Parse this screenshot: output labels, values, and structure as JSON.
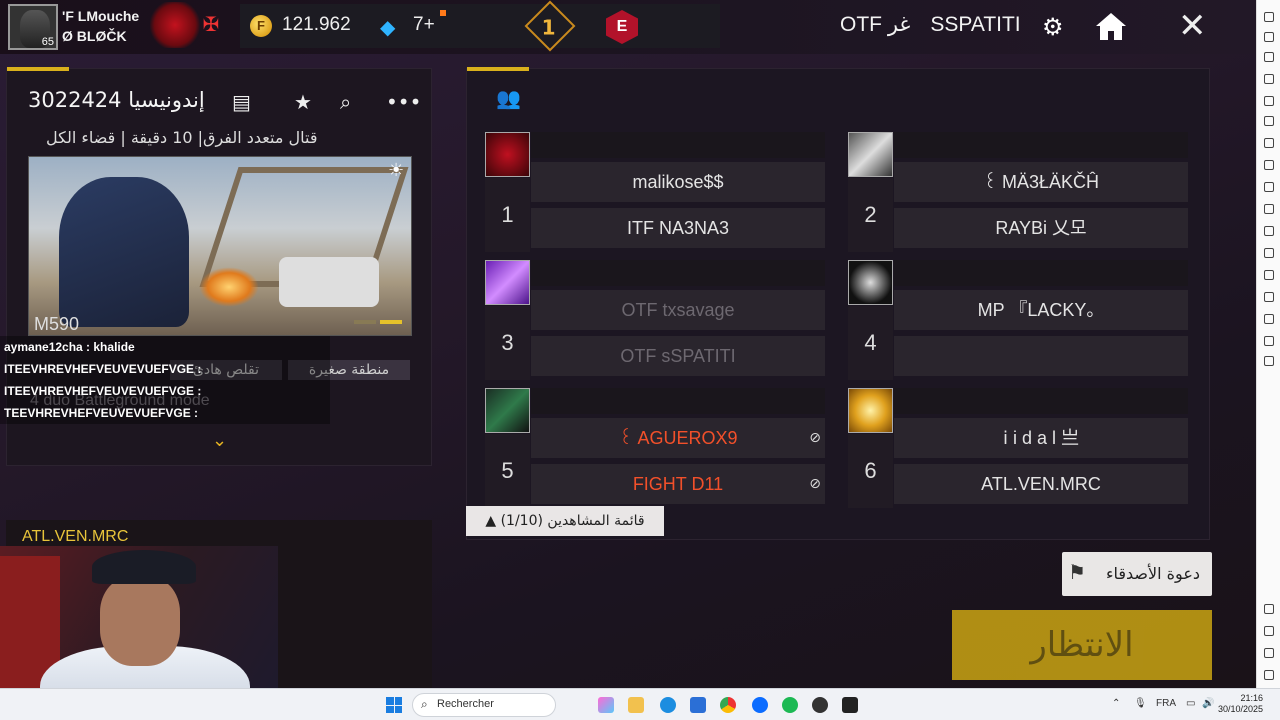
{
  "player": {
    "line1": "'F   LMouche",
    "line2": "Ø     BLØČK",
    "level": "65"
  },
  "currency": {
    "coins": "121.962",
    "coin_symbol": "F",
    "diamonds": "7+"
  },
  "ranks": {
    "rank1": "1",
    "rankE": "E"
  },
  "host": {
    "tag1": "OTF غر",
    "tag2": "SSPATITI"
  },
  "room": {
    "title": "3022424 إندونيسيا",
    "rules": "قتال متعدد الفرق|  10 دقيقة   |   قضاء الكل",
    "map_name": "M590",
    "chip1": "منطقة صغيرة",
    "chip2": "تقلص هادئ",
    "mode_ghost": "4 duo Battleground mode"
  },
  "chat": [
    "aymane12cha : khalide",
    "ITEEVHREVHEFVEUVEVUEFVGE :",
    "ITEEVHREVHEFVEUVEVUEFVGE :",
    "TEEVHREVHEFVEUVEVUEFVGE :"
  ],
  "spectator_highlight": "ATL.VEN.MRC",
  "teams": [
    {
      "num": "1",
      "p1": "malikose$$",
      "p2": "ITF   NA3NA3"
    },
    {
      "num": "2",
      "p1": "꒰   MÄ3ŁÄKČĤ",
      "p2": "RAYBi   乂모"
    },
    {
      "num": "3",
      "p1": "OTF   txsavage",
      "p2": "OTF   sSPATITI"
    },
    {
      "num": "4",
      "p1": "MP    『LACKY。",
      "p2": ""
    },
    {
      "num": "5",
      "p1": "꒰   AGUEROX9",
      "p2": "FIGHT   D11"
    },
    {
      "num": "6",
      "p1": "ⅰ i d a l  亗",
      "p2": "ATL.VEN.MRC"
    }
  ],
  "spectators_label": "(1/10)  قائمة المشاهدين",
  "invite_label": "دعوة الأصدقاء",
  "wait_label": "الانتظار",
  "taskbar": {
    "search_placeholder": "Rechercher",
    "lang": "FRA",
    "time": "21:16",
    "date": "30/10/2025"
  },
  "colors": {
    "accent": "#d9b01c",
    "wait_button": "#caa413",
    "red_name": "#f2502a"
  }
}
